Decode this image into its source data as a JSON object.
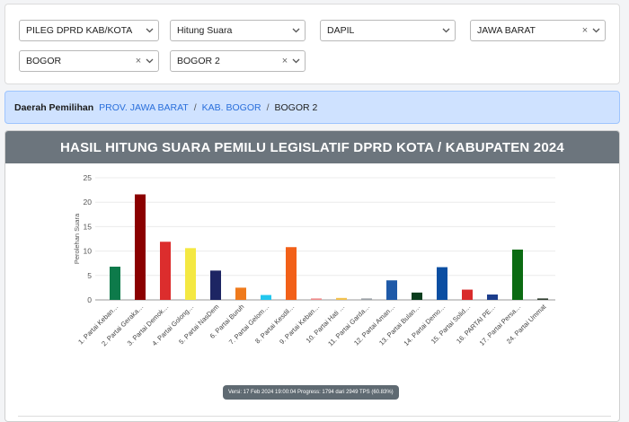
{
  "filters": [
    {
      "value": "PILEG DPRD KAB/KOTA",
      "clearable": false
    },
    {
      "value": "Hitung Suara",
      "clearable": false
    },
    {
      "value": "DAPIL",
      "clearable": false
    },
    {
      "value": "JAWA BARAT",
      "clearable": true
    },
    {
      "value": "BOGOR",
      "clearable": true
    },
    {
      "value": "BOGOR 2",
      "clearable": true
    }
  ],
  "breadcrumb": {
    "label": "Daerah Pemilihan",
    "province": "PROV. JAWA BARAT",
    "regency": "KAB. BOGOR",
    "current": "BOGOR 2",
    "separator": "/"
  },
  "panel": {
    "title": "HASIL HITUNG SUARA PEMILU LEGISLATIF DPRD KOTA / KABUPATEN 2024",
    "version_text": "Versi: 17 Feb 2024 19:00:04 Progress: 1794 dari 2949 TPS (60.83%)"
  },
  "chart_data": {
    "type": "bar",
    "ylabel": "Perolehan Suara",
    "xlabel": "",
    "ylim": [
      0,
      25
    ],
    "yticks": [
      0,
      5,
      10,
      15,
      20,
      25
    ],
    "grid": true,
    "categories": [
      "1. Partai Keban…",
      "2. Partai Gerakа…",
      "3. Partai Demok…",
      "4. Partai Golong…",
      "5. Partai NasDem",
      "6. Partai Buruh",
      "7. Partai Gelom…",
      "8. Partai Kesdil…",
      "9. Partai Keban…",
      "10. Partai Hati …",
      "11. Partai Garda…",
      "12. Partai Aman…",
      "13. Partai Bulan…",
      "14. Partai Demo…",
      "15. Partai Solid…",
      "16. PARTAI PE…",
      "17. Partai Persa…",
      "24. Partai Ummat"
    ],
    "values": [
      6.8,
      21.6,
      11.9,
      10.6,
      6.0,
      2.5,
      1.0,
      10.8,
      0.3,
      0.4,
      0.3,
      4.0,
      1.5,
      6.7,
      2.1,
      1.1,
      10.3,
      0.3
    ],
    "colors": [
      "#0d7a4a",
      "#8b0000",
      "#dc2d2d",
      "#f4e842",
      "#1d2563",
      "#ef7a1c",
      "#23c7ee",
      "#f26018",
      "#ef8b8b",
      "#f2c14e",
      "#9aa0a6",
      "#1f5aa8",
      "#0b3d1e",
      "#0b4ea2",
      "#d92b2b",
      "#1c3d8c",
      "#0b6b12",
      "#2f3d2f"
    ]
  }
}
